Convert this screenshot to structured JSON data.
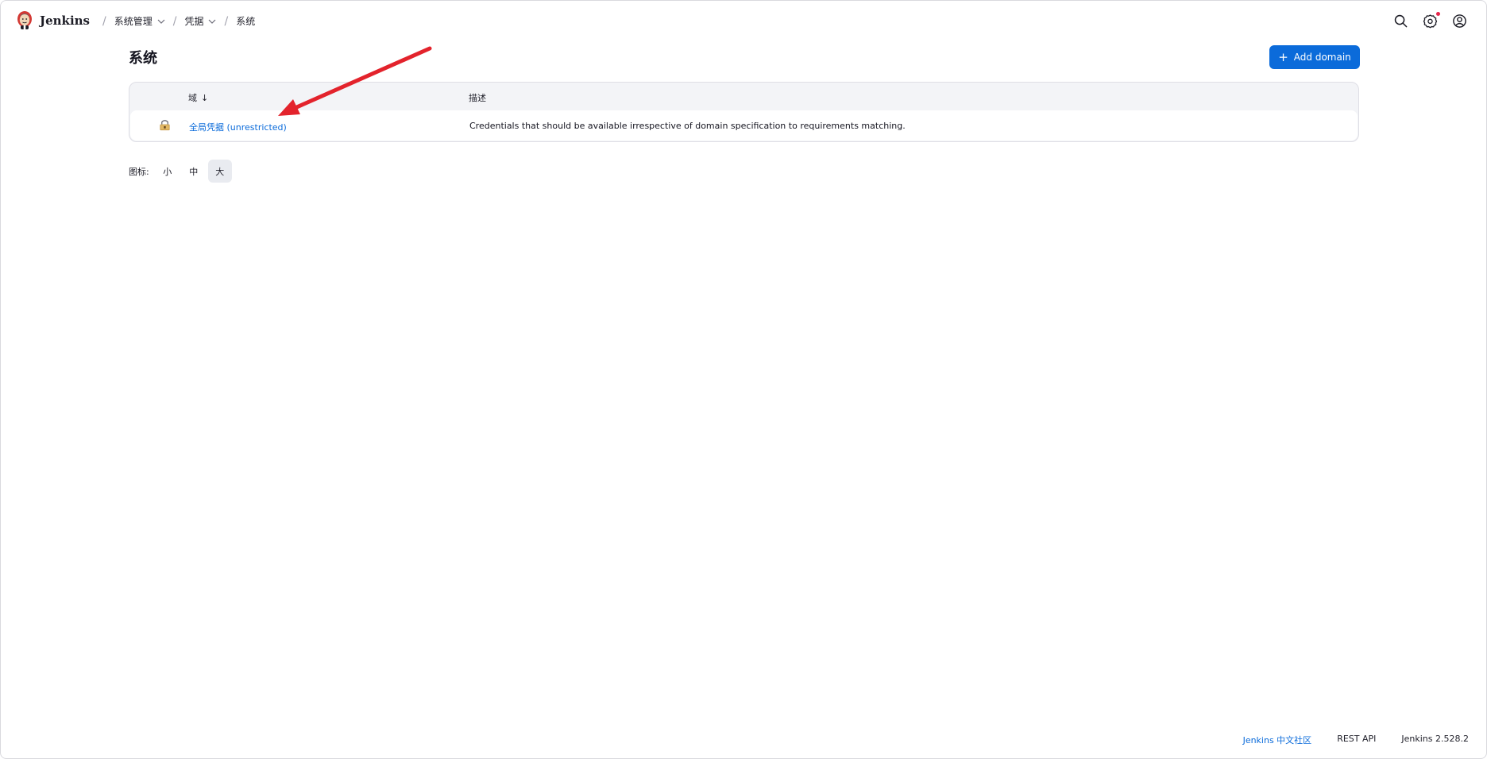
{
  "header": {
    "logo_text": "Jenkins",
    "breadcrumbs": [
      {
        "label": "系统管理",
        "has_dropdown": true
      },
      {
        "label": "凭据",
        "has_dropdown": true
      },
      {
        "label": "系统",
        "has_dropdown": false
      }
    ],
    "icons": [
      "search-icon",
      "settings-gear-icon",
      "user-account-icon"
    ],
    "settings_notification": true
  },
  "main": {
    "title": "系统",
    "add_button_label": "Add domain",
    "table": {
      "columns": {
        "domain": "域",
        "sort_indicator": "↓",
        "description": "描述"
      },
      "rows": [
        {
          "icon": "credentials-store-icon",
          "domain": "全局凭据 (unrestricted)",
          "description": "Credentials that should be available irrespective of domain specification to requirements matching."
        }
      ]
    },
    "icon_size": {
      "label": "图标:",
      "options": [
        "小",
        "中",
        "大"
      ],
      "selected": "大"
    }
  },
  "footer": {
    "community_link": "Jenkins 中文社区",
    "rest_api_link": "REST API",
    "version": "Jenkins 2.528.2"
  },
  "colors": {
    "accent": "#0b6bda",
    "annotation_arrow": "#e3232c",
    "notification": "#e5264b"
  }
}
